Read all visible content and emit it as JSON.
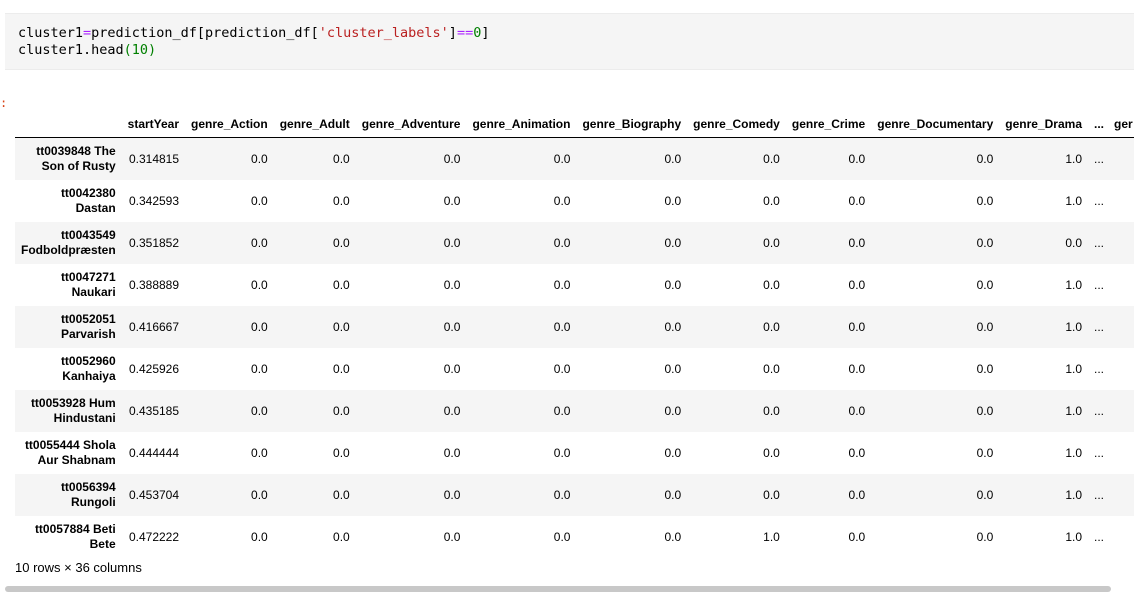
{
  "code": {
    "line1": {
      "p1": "cluster1",
      "eq": "=",
      "p2": "prediction_df[prediction_df[",
      "str": "'cluster_labels'",
      "p3": "]",
      "eqeq": "==",
      "num": "0",
      "p4": "]"
    },
    "line2": {
      "p1": "cluster1.head",
      "num": "(10)"
    }
  },
  "output_prompt": ":",
  "table": {
    "columns": [
      "startYear",
      "genre_Action",
      "genre_Adult",
      "genre_Adventure",
      "genre_Animation",
      "genre_Biography",
      "genre_Comedy",
      "genre_Crime",
      "genre_Documentary",
      "genre_Drama",
      "...",
      "ger"
    ],
    "rows": [
      {
        "index": "tt0039848 The Son of Rusty",
        "values": [
          "0.314815",
          "0.0",
          "0.0",
          "0.0",
          "0.0",
          "0.0",
          "0.0",
          "0.0",
          "0.0",
          "1.0",
          "..."
        ]
      },
      {
        "index": "tt0042380 Dastan",
        "values": [
          "0.342593",
          "0.0",
          "0.0",
          "0.0",
          "0.0",
          "0.0",
          "0.0",
          "0.0",
          "0.0",
          "1.0",
          "..."
        ]
      },
      {
        "index": "tt0043549 Fodboldpræsten",
        "values": [
          "0.351852",
          "0.0",
          "0.0",
          "0.0",
          "0.0",
          "0.0",
          "0.0",
          "0.0",
          "0.0",
          "0.0",
          "..."
        ]
      },
      {
        "index": "tt0047271 Naukari",
        "values": [
          "0.388889",
          "0.0",
          "0.0",
          "0.0",
          "0.0",
          "0.0",
          "0.0",
          "0.0",
          "0.0",
          "1.0",
          "..."
        ]
      },
      {
        "index": "tt0052051 Parvarish",
        "values": [
          "0.416667",
          "0.0",
          "0.0",
          "0.0",
          "0.0",
          "0.0",
          "0.0",
          "0.0",
          "0.0",
          "1.0",
          "..."
        ]
      },
      {
        "index": "tt0052960 Kanhaiya",
        "values": [
          "0.425926",
          "0.0",
          "0.0",
          "0.0",
          "0.0",
          "0.0",
          "0.0",
          "0.0",
          "0.0",
          "1.0",
          "..."
        ]
      },
      {
        "index": "tt0053928 Hum Hindustani",
        "values": [
          "0.435185",
          "0.0",
          "0.0",
          "0.0",
          "0.0",
          "0.0",
          "0.0",
          "0.0",
          "0.0",
          "1.0",
          "..."
        ]
      },
      {
        "index": "tt0055444 Shola Aur Shabnam",
        "values": [
          "0.444444",
          "0.0",
          "0.0",
          "0.0",
          "0.0",
          "0.0",
          "0.0",
          "0.0",
          "0.0",
          "1.0",
          "..."
        ]
      },
      {
        "index": "tt0056394 Rungoli",
        "values": [
          "0.453704",
          "0.0",
          "0.0",
          "0.0",
          "0.0",
          "0.0",
          "0.0",
          "0.0",
          "0.0",
          "1.0",
          "..."
        ]
      },
      {
        "index": "tt0057884 Beti Bete",
        "values": [
          "0.472222",
          "0.0",
          "0.0",
          "0.0",
          "0.0",
          "0.0",
          "1.0",
          "0.0",
          "0.0",
          "1.0",
          "..."
        ]
      }
    ],
    "footer": "10 rows × 36 columns"
  },
  "colors": {
    "code_background": "#f5f5f5",
    "operator": "#aa22ff",
    "string": "#ba2121",
    "number": "#008000",
    "prompt": "#d84315",
    "stripe": "#f5f5f5"
  }
}
